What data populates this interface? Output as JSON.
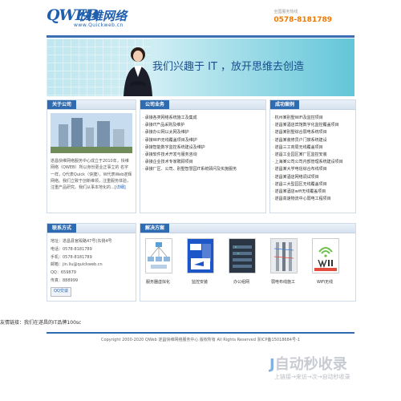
{
  "header": {
    "logo_text": "QWEB",
    "logo_cn": "快维网络",
    "logo_url": "www.Quickweb.cn",
    "hotline_label": "全国服务热线",
    "hotline_number": "0578-8181789"
  },
  "banner": {
    "slogan": "我们兴趣于 IT ，放开思维去创造"
  },
  "about": {
    "title": "关于公司",
    "text": "遂昌快维网络服务中心成立于2010年，快维网络（QWEB）所以身份更业正事立的 名字一样，Q代表Quick（快捷），W代表Web遂辉网络。我们立致于创新维领，注重服务体验，注重产品研究。我们从事本地化的...",
    "more": "[详细]"
  },
  "services": {
    "title": "公司业务",
    "items": [
      "承接各类网络系统施工及集成",
      "承接IT产品采购及维护",
      "承接办公网以太网及维护",
      "承接WiFi无线覆盖项目及维护",
      "承接智能数字监控系统建设及维护",
      "承接软件技术开发与服务咨询",
      "承接企业技术专家聘顾项目",
      "承接厂区、公司、别墅智慧园IT系统顾问及实施服务"
    ]
  },
  "cases": {
    "title": "成功案例",
    "items": [
      "杭州某别墅WiFi及监控项目",
      "遂昌某酒店宾馆数字化监控覆盖项目",
      "遂昌某别墅综合弱电系统项目",
      "遂昌某装修员户门禁系统建设",
      "遂昌三工商局无线覆盖项目",
      "遂昌工业园区某厂区监控安装",
      "上海某公司公司内部管理系统建设项目",
      "遂昌某大学电信综合布线项目",
      "遂昌某酒店网络调试项目",
      "遂昌三大型园区无线覆盖项目",
      "遂昌某酒店wifi无线覆盖项目",
      "遂昌高速物流中心弱电工程项目"
    ]
  },
  "contact": {
    "title": "联系方式",
    "lines": [
      "地址：遂昌县官殿路47号(东侧4号",
      "电话：0578-8181789",
      "手机：0578-8181789",
      "邮箱：jin.liu@quickweb.cn",
      "QQ：659879",
      "传真：888999"
    ],
    "qq_button": "QQ交谈"
  },
  "solutions": {
    "title": "解决方案",
    "items": [
      "服务器虚拟化",
      "监控安装",
      "办公组网",
      "弱电布线施工",
      "WiFi无线"
    ]
  },
  "friend_link": "友情链接：我们在遂昌的IT品牌100sc",
  "footer": "Copyright 2000-2020 QWeb 遂昌快维网络服务中心 版权所有 All Rights Reserved 浙ICP备15018684号-1",
  "watermark": {
    "logo": "自动秒收录",
    "tagline": "上链接→来访→次→自动秒收录"
  }
}
